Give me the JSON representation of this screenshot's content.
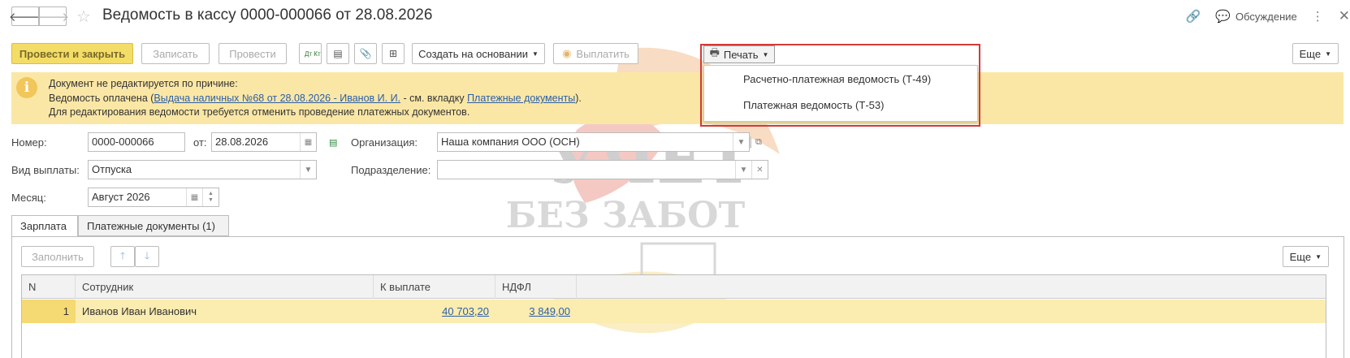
{
  "window": {
    "title": "Ведомость в кассу 0000-000066 от 28.08.2026",
    "discuss_label": "Обсуждение"
  },
  "toolbar": {
    "post_and_close": "Провести и закрыть",
    "save": "Записать",
    "post": "Провести",
    "dt_kt": "Дт Кт",
    "create_based_on": "Создать на основании",
    "pay": "Выплатить",
    "print": "Печать",
    "more": "Еще"
  },
  "print_menu": {
    "items": [
      "Расчетно-платежная ведомость (Т-49)",
      "Платежная ведомость (Т-53)"
    ]
  },
  "info": {
    "line1": "Документ не редактируется по причине:",
    "line2_prefix": "Ведомость оплачена (",
    "line2_link1": "Выдача наличных №68 от 28.08.2026 - Иванов И. И.",
    "line2_middle": " - см. вкладку ",
    "line2_link2": "Платежные документы",
    "line2_suffix": ").",
    "line3": "Для редактирования ведомости требуется отменить проведение платежных документов."
  },
  "form": {
    "number_label": "Номер:",
    "number_value": "0000-000066",
    "date_label": "от:",
    "date_value": "28.08.2026",
    "org_label": "Организация:",
    "org_value": "Наша компания ООО (ОСН)",
    "payment_type_label": "Вид выплаты:",
    "payment_type_value": "Отпуска",
    "department_label": "Подразделение:",
    "department_value": "",
    "month_label": "Месяц:",
    "month_value": "Август 2026"
  },
  "tabs": [
    {
      "label": "Зарплата"
    },
    {
      "label": "Платежные документы (1)"
    }
  ],
  "panel": {
    "fill_button": "Заполнить",
    "more": "Еще"
  },
  "table": {
    "columns": [
      "N",
      "Сотрудник",
      "К выплате",
      "НДФЛ"
    ],
    "rows": [
      {
        "n": "1",
        "employee": "Иванов Иван Иванович",
        "to_pay": "40 703,20",
        "ndfl": "3 849,00"
      }
    ]
  },
  "watermark": {
    "line1": "УЧЕТ",
    "line2": "БЕЗ ЗАБОТ"
  },
  "colors": {
    "primary_button": "#f4dd66",
    "info_bar": "#fbe7a5",
    "selected_row": "#fbecb0",
    "highlight_border": "#d23a3a",
    "link": "#2b5fa8"
  }
}
